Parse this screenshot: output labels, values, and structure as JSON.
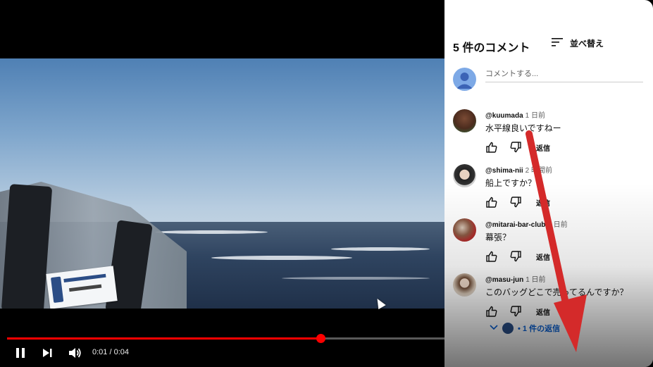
{
  "player": {
    "time_display": "0:01 / 0:04",
    "progress_fraction": 0.25,
    "accent_color": "#ff0000"
  },
  "comments_panel": {
    "title": "5 件のコメント",
    "sort_label": "並べ替え",
    "add_placeholder": "コメントする...",
    "comments": [
      {
        "author": "@kuumada",
        "time": "1 日前",
        "text": "水平線良いですねー",
        "reply_label": "返信"
      },
      {
        "author": "@shima-nii",
        "time": "2 時間前",
        "text": "船上ですか？",
        "reply_label": "返信"
      },
      {
        "author": "@mitarai-bar-club",
        "time": "1 日前",
        "text": "幕張？",
        "reply_label": "返信"
      },
      {
        "author": "@masu-jun",
        "time": "1 日前",
        "text": "このバッグどこで売ってるんですか？",
        "reply_label": "返信"
      }
    ],
    "replies_label": "• 1 件の返信"
  },
  "icons": [
    "pause-icon",
    "next-icon",
    "volume-icon",
    "subtitles-icon",
    "settings-icon",
    "miniplayer-icon",
    "comments-panel-icon",
    "theater-icon",
    "fullscreen-icon",
    "sort-icon",
    "like-icon",
    "dislike-icon",
    "chevron-down-icon"
  ],
  "annotation": {
    "arrow_color": "#d42a2a"
  }
}
